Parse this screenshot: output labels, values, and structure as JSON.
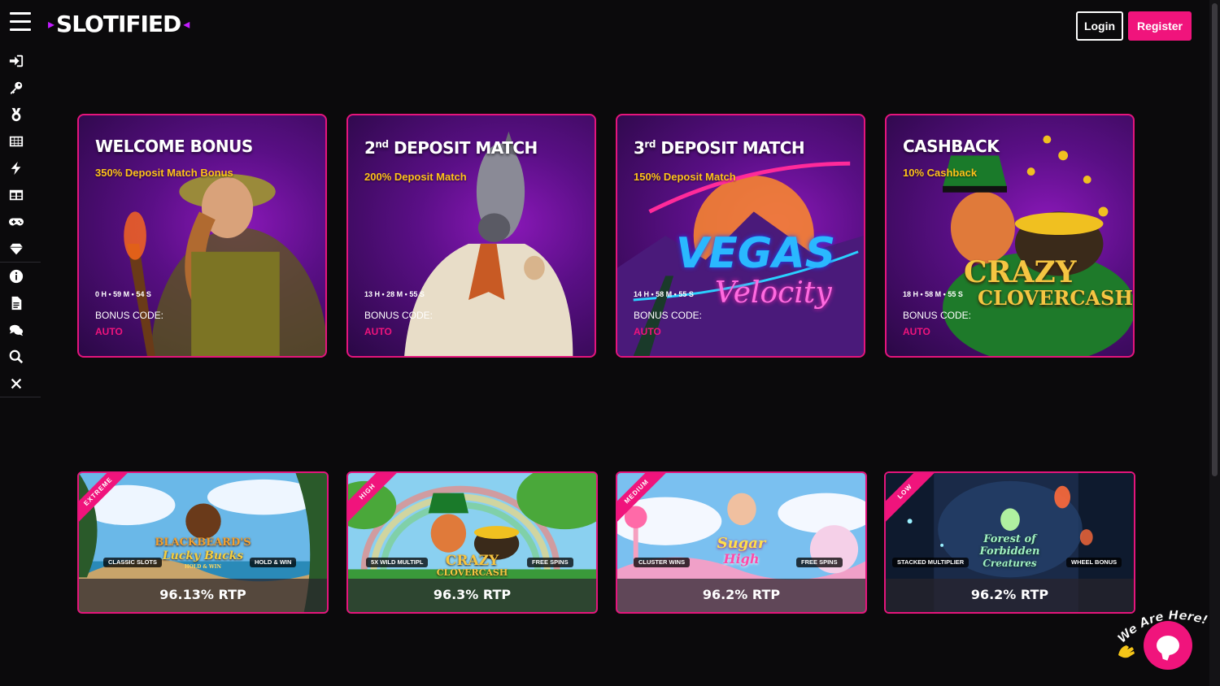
{
  "header": {
    "logo_text": "SLOTIFIED",
    "login_label": "Login",
    "register_label": "Register",
    "accent_color": "#f0147c"
  },
  "sidebar": {
    "items": [
      {
        "icon": "sign-in-icon"
      },
      {
        "icon": "key-icon"
      },
      {
        "icon": "medal-icon"
      },
      {
        "icon": "grid-icon"
      },
      {
        "icon": "lightning-icon"
      },
      {
        "icon": "table-icon"
      },
      {
        "icon": "gamepad-icon"
      },
      {
        "icon": "diamond-icon"
      },
      {
        "icon": "info-icon"
      },
      {
        "icon": "document-icon"
      },
      {
        "icon": "chat-icon"
      },
      {
        "icon": "search-icon"
      },
      {
        "icon": "close-icon"
      }
    ]
  },
  "promos": [
    {
      "title": "WELCOME BONUS",
      "subtitle": "350% Deposit Match Bonus",
      "timer": "0 H • 59 M • 54 S",
      "code_label": "BONUS CODE:",
      "code": "AUTO"
    },
    {
      "title_num": "2",
      "title_sup": "nd",
      "title_rest": " DEPOSIT MATCH",
      "subtitle": "200% Deposit Match",
      "timer": "13 H • 28 M • 55 S",
      "code_label": "BONUS CODE:",
      "code": "AUTO"
    },
    {
      "title_num": "3",
      "title_sup": "rd",
      "title_rest": " DEPOSIT MATCH",
      "subtitle": "150% Deposit Match",
      "timer": "14 H • 58 M • 55 S",
      "code_label": "BONUS CODE:",
      "code": "AUTO",
      "art_text_1": "VEGAS",
      "art_text_2": "Velocity"
    },
    {
      "title": "CASHBACK",
      "subtitle": "10% Cashback",
      "timer": "18 H • 58 M • 55 S",
      "code_label": "BONUS CODE:",
      "code": "AUTO",
      "art_text_1": "CRAZY",
      "art_text_2": "CLOVERCASH"
    }
  ],
  "games": [
    {
      "volatility": "EXTREME",
      "tags": [
        "CLASSIC SLOTS",
        "HOLD & WIN"
      ],
      "rtp": "96.13% RTP",
      "logo_1": "BLACKBEARD'S",
      "logo_2": "Lucky Bucks",
      "logo_3": "HOLD & WIN"
    },
    {
      "volatility": "HIGH",
      "tags": [
        "5X WILD MULTIPL",
        "FREE SPINS"
      ],
      "rtp": "96.3% RTP",
      "logo_1": "CRAZY",
      "logo_2": "CLOVERCASH"
    },
    {
      "volatility": "MEDIUM",
      "tags": [
        "CLUSTER WINS",
        "FREE SPINS"
      ],
      "rtp": "96.2% RTP",
      "logo_1": "Sugar",
      "logo_2": "High"
    },
    {
      "volatility": "LOW",
      "tags": [
        "STACKED MULTIPLIER",
        "WHEEL BONUS"
      ],
      "rtp": "96.2% RTP",
      "logo_1": "Forest of",
      "logo_2": "Forbidden",
      "logo_3": "Creatures"
    }
  ],
  "chat": {
    "label": "We Are Here!"
  }
}
